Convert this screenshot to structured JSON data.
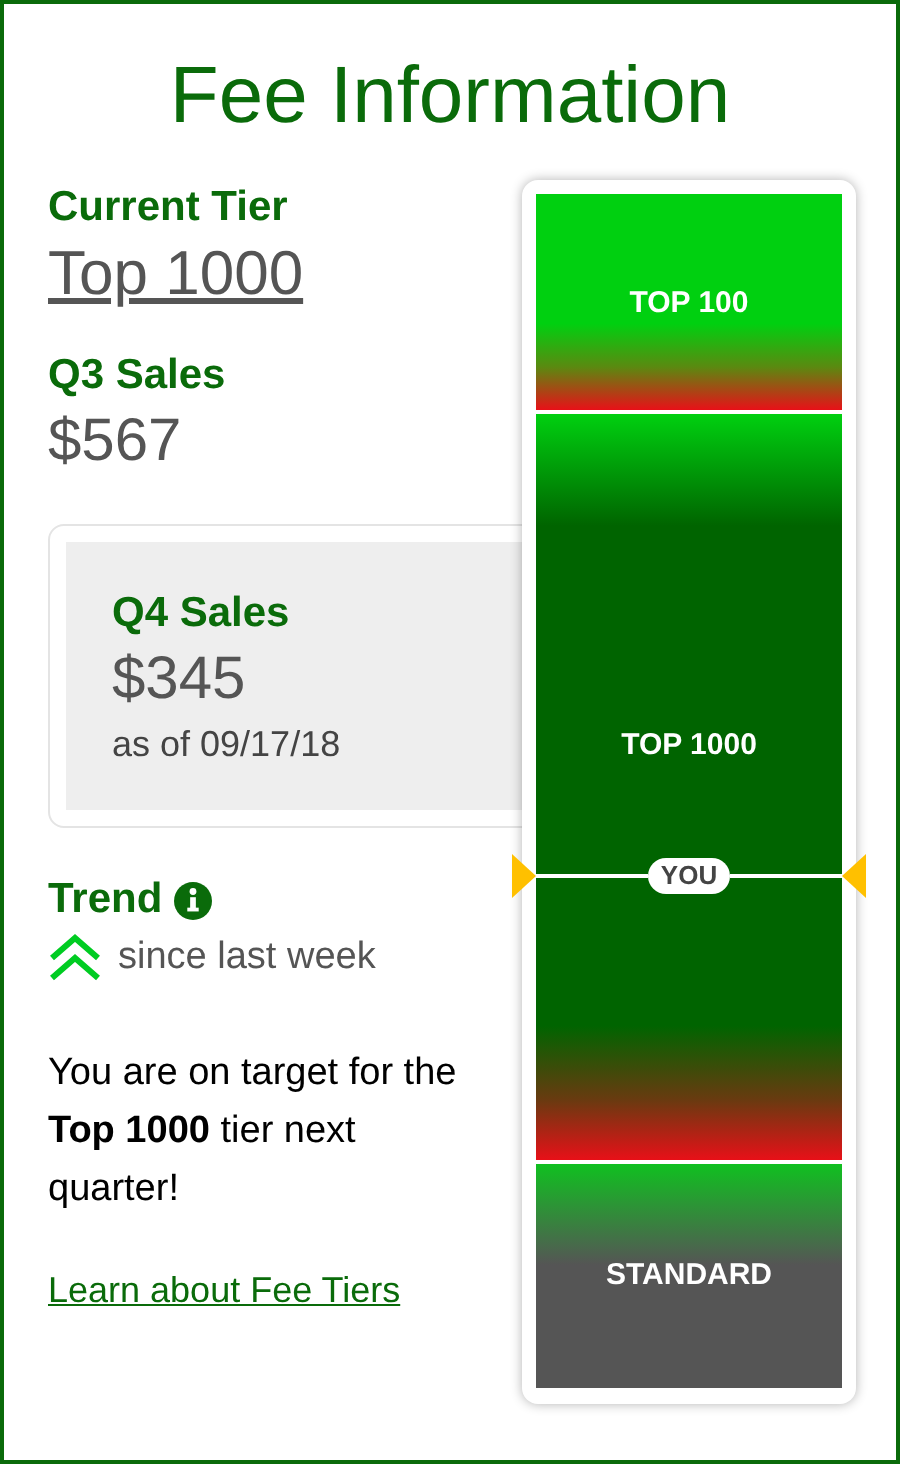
{
  "title": "Fee Information",
  "current_tier": {
    "label": "Current Tier",
    "value": "Top 1000"
  },
  "q3_sales": {
    "label": "Q3 Sales",
    "value": "$567"
  },
  "q4_sales": {
    "label": "Q4 Sales",
    "value": "$345",
    "as_of": "as of 09/17/18"
  },
  "trend": {
    "label": "Trend",
    "rising": true,
    "text": "since last week"
  },
  "message": "You are on target for the **Top 1000** tier next quarter!",
  "link": "Learn about Fee Tiers",
  "tiers": [
    {
      "label": "TOP 100",
      "kind": "top",
      "selected": false
    },
    {
      "label": "TOP 1000",
      "kind": "middle",
      "selected": true
    },
    {
      "label": "STANDARD",
      "kind": "base",
      "selected": false
    }
  ],
  "marker": {
    "label": "YOU"
  }
}
